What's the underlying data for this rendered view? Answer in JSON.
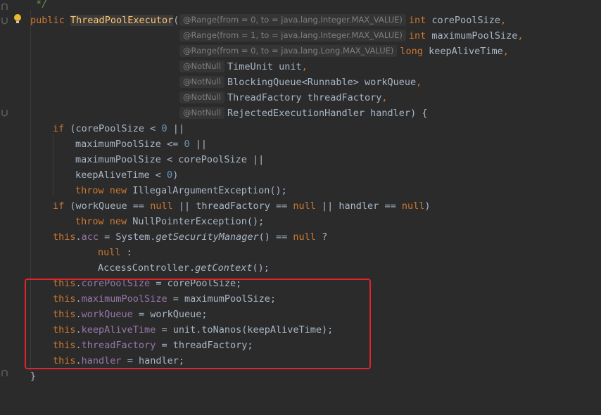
{
  "editor": {
    "comment_end": "*/",
    "signature": {
      "kw_public": "public",
      "name": "ThreadPoolExecutor",
      "open_paren": "(",
      "params": [
        {
          "anno": "@Range(from = 0, to = java.lang.Integer.MAX_VALUE)",
          "type": "int",
          "name": "corePoolSize",
          "sep": ","
        },
        {
          "anno": "@Range(from = 1, to = java.lang.Integer.MAX_VALUE)",
          "type": "int",
          "name": "maximumPoolSize",
          "sep": ","
        },
        {
          "anno": "@Range(from = 0, to = java.lang.Long.MAX_VALUE)",
          "type": "long",
          "name": "keepAliveTime",
          "sep": ","
        },
        {
          "anno": "@NotNull",
          "type": "TimeUnit",
          "name": "unit",
          "sep": ","
        },
        {
          "anno": "@NotNull",
          "type": "BlockingQueue<Runnable>",
          "name": "workQueue",
          "sep": ","
        },
        {
          "anno": "@NotNull",
          "type": "ThreadFactory",
          "name": "threadFactory",
          "sep": ","
        },
        {
          "anno": "@NotNull",
          "type": "RejectedExecutionHandler",
          "name": "handler",
          "sep": ") {"
        }
      ]
    },
    "body": {
      "if1_kw": "if",
      "if1_text": " (corePoolSize < ",
      "zero": "0",
      "or": " ||",
      "max_le": "maximumPoolSize <= ",
      "max_lt": "maximumPoolSize < corePoolSize ||",
      "keep_lt": "keepAliveTime < ",
      "close_paren": ")",
      "throw_kw": "throw",
      "new_kw": "new",
      "iae": " IllegalArgumentException();",
      "if2_text1": " (workQueue == ",
      "null_kw": "null",
      "if2_text2": " || threadFactory == ",
      "if2_text3": " || handler == ",
      "npe": " NullPointerException();",
      "this_kw": "this",
      "acc_field": "acc",
      "acc_eq": " = System.",
      "get_sm": "getSecurityManager",
      "acc_rest": "() == ",
      "question": " ?",
      "colon": " :",
      "ac_prefix": "AccessController.",
      "get_ctx": "getContext",
      "ac_suffix": "();",
      "assignments": [
        {
          "field": "corePoolSize",
          "rhs": " = corePoolSize;"
        },
        {
          "field": "maximumPoolSize",
          "rhs": " = maximumPoolSize;"
        },
        {
          "field": "workQueue",
          "rhs": " = workQueue;"
        },
        {
          "field": "keepAliveTime",
          "rhs": " = unit.toNanos(keepAliveTime);"
        },
        {
          "field": "threadFactory",
          "rhs": " = threadFactory;"
        },
        {
          "field": "handler",
          "rhs": " = handler;"
        }
      ],
      "close_brace": "}"
    },
    "highlight_color": "#e0242b",
    "icons": {
      "bulb": "lightbulb-icon",
      "fold": "fold-marker-icon"
    }
  }
}
